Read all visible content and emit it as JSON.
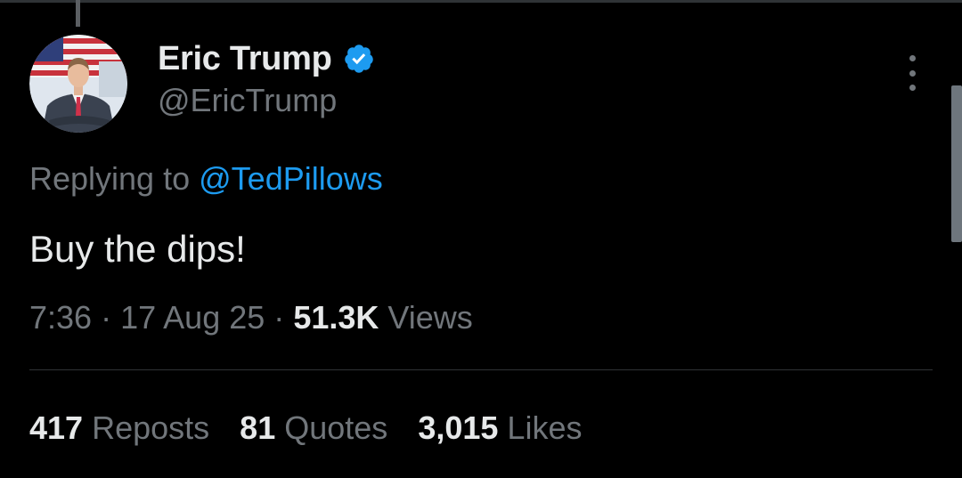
{
  "tweet": {
    "author": {
      "display_name": "Eric Trump",
      "handle": "@EricTrump",
      "verified_icon": "verified-badge-icon",
      "avatar": "avatar-portrait"
    },
    "reply": {
      "prefix": "Replying to",
      "target_handle": "@TedPillows"
    },
    "text": "Buy the dips!",
    "meta": {
      "time": "7:36",
      "separator": "·",
      "date": "17 Aug 25",
      "views_count": "51.3K",
      "views_label": "Views"
    },
    "stats": [
      {
        "count": "417",
        "label": "Reposts"
      },
      {
        "count": "81",
        "label": "Quotes"
      },
      {
        "count": "3,015",
        "label": "Likes"
      }
    ],
    "more_icon": "more-options-icon"
  },
  "colors": {
    "background": "#000000",
    "primary_text": "#e7e9ea",
    "secondary_text": "#71767b",
    "accent": "#1d9bf0",
    "divider": "#2f3336"
  }
}
